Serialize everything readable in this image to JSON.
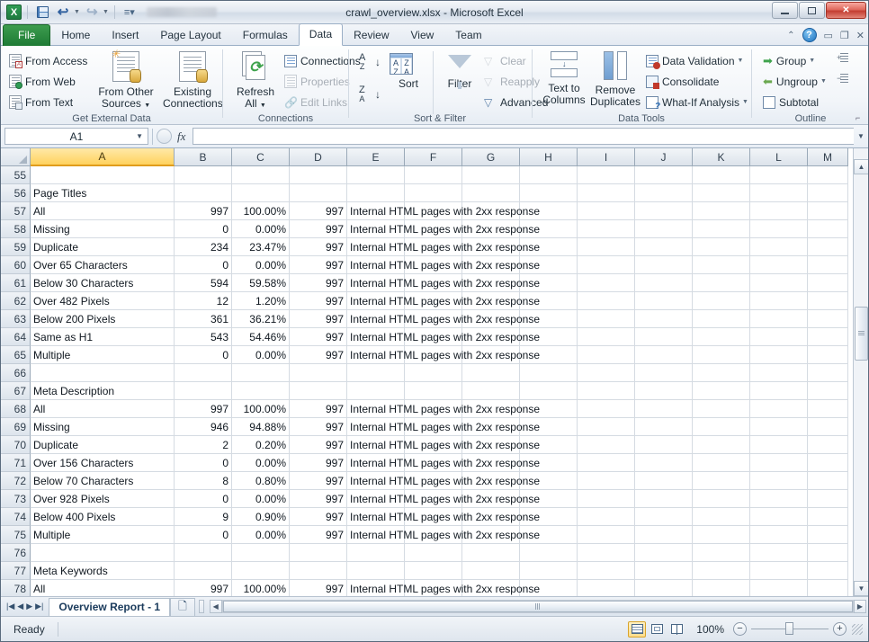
{
  "window": {
    "title": "crawl_overview.xlsx  -  Microsoft Excel",
    "quick_access": [
      "save-icon",
      "undo-icon",
      "redo-icon",
      "customize-icon"
    ],
    "controls": {
      "minimize": "—",
      "restore": "❐",
      "close": "✕"
    }
  },
  "ribbon": {
    "tabs": [
      {
        "label": "File",
        "active": false,
        "file": true
      },
      {
        "label": "Home",
        "active": false
      },
      {
        "label": "Insert",
        "active": false
      },
      {
        "label": "Page Layout",
        "active": false
      },
      {
        "label": "Formulas",
        "active": false
      },
      {
        "label": "Data",
        "active": true
      },
      {
        "label": "Review",
        "active": false
      },
      {
        "label": "View",
        "active": false
      },
      {
        "label": "Team",
        "active": false
      }
    ],
    "help_label": "?",
    "groups": {
      "get_external_data": {
        "title": "Get External Data",
        "from_access": "From Access",
        "from_web": "From Web",
        "from_text": "From Text",
        "from_other_sources_line1": "From Other",
        "from_other_sources_line2": "Sources",
        "existing_connections_line1": "Existing",
        "existing_connections_line2": "Connections"
      },
      "connections": {
        "title": "Connections",
        "refresh_all_line1": "Refresh",
        "refresh_all_line2": "All",
        "connections": "Connections",
        "properties": "Properties",
        "edit_links": "Edit Links"
      },
      "sort_filter": {
        "title": "Sort & Filter",
        "sort_asc": "A→Z",
        "sort_desc": "Z→A",
        "sort": "Sort",
        "filter": "Filter",
        "clear": "Clear",
        "reapply": "Reapply",
        "advanced": "Advanced"
      },
      "data_tools": {
        "title": "Data Tools",
        "text_to_columns_line1": "Text to",
        "text_to_columns_line2": "Columns",
        "remove_duplicates_line1": "Remove",
        "remove_duplicates_line2": "Duplicates",
        "data_validation": "Data Validation",
        "consolidate": "Consolidate",
        "what_if_analysis": "What-If Analysis"
      },
      "outline": {
        "title": "Outline",
        "group": "Group",
        "ungroup": "Ungroup",
        "subtotal": "Subtotal"
      }
    }
  },
  "formula_bar": {
    "name_box": "A1",
    "formula_value": "",
    "fx_label": "fx"
  },
  "grid": {
    "column_headers": [
      "A",
      "B",
      "C",
      "D",
      "E",
      "F",
      "G",
      "H",
      "I",
      "J",
      "K",
      "L",
      "M"
    ],
    "selected_column": "A",
    "selected_cell": "A1",
    "rows": [
      {
        "n": "55",
        "a": "",
        "b": "",
        "c": "",
        "d": "",
        "e": ""
      },
      {
        "n": "56",
        "a": "Page Titles",
        "b": "",
        "c": "",
        "d": "",
        "e": ""
      },
      {
        "n": "57",
        "a": "All",
        "b": "997",
        "c": "100.00%",
        "d": "997",
        "e": "Internal HTML pages with 2xx response"
      },
      {
        "n": "58",
        "a": "Missing",
        "b": "0",
        "c": "0.00%",
        "d": "997",
        "e": "Internal HTML pages with 2xx response"
      },
      {
        "n": "59",
        "a": "Duplicate",
        "b": "234",
        "c": "23.47%",
        "d": "997",
        "e": "Internal HTML pages with 2xx response"
      },
      {
        "n": "60",
        "a": "Over 65 Characters",
        "b": "0",
        "c": "0.00%",
        "d": "997",
        "e": "Internal HTML pages with 2xx response"
      },
      {
        "n": "61",
        "a": "Below 30 Characters",
        "b": "594",
        "c": "59.58%",
        "d": "997",
        "e": "Internal HTML pages with 2xx response"
      },
      {
        "n": "62",
        "a": "Over 482 Pixels",
        "b": "12",
        "c": "1.20%",
        "d": "997",
        "e": "Internal HTML pages with 2xx response"
      },
      {
        "n": "63",
        "a": "Below 200 Pixels",
        "b": "361",
        "c": "36.21%",
        "d": "997",
        "e": "Internal HTML pages with 2xx response"
      },
      {
        "n": "64",
        "a": "Same as H1",
        "b": "543",
        "c": "54.46%",
        "d": "997",
        "e": "Internal HTML pages with 2xx response"
      },
      {
        "n": "65",
        "a": "Multiple",
        "b": "0",
        "c": "0.00%",
        "d": "997",
        "e": "Internal HTML pages with 2xx response"
      },
      {
        "n": "66",
        "a": "",
        "b": "",
        "c": "",
        "d": "",
        "e": ""
      },
      {
        "n": "67",
        "a": "Meta Description",
        "b": "",
        "c": "",
        "d": "",
        "e": ""
      },
      {
        "n": "68",
        "a": "All",
        "b": "997",
        "c": "100.00%",
        "d": "997",
        "e": "Internal HTML pages with 2xx response"
      },
      {
        "n": "69",
        "a": "Missing",
        "b": "946",
        "c": "94.88%",
        "d": "997",
        "e": "Internal HTML pages with 2xx response"
      },
      {
        "n": "70",
        "a": "Duplicate",
        "b": "2",
        "c": "0.20%",
        "d": "997",
        "e": "Internal HTML pages with 2xx response"
      },
      {
        "n": "71",
        "a": "Over 156 Characters",
        "b": "0",
        "c": "0.00%",
        "d": "997",
        "e": "Internal HTML pages with 2xx response"
      },
      {
        "n": "72",
        "a": "Below 70 Characters",
        "b": "8",
        "c": "0.80%",
        "d": "997",
        "e": "Internal HTML pages with 2xx response"
      },
      {
        "n": "73",
        "a": "Over 928 Pixels",
        "b": "0",
        "c": "0.00%",
        "d": "997",
        "e": "Internal HTML pages with 2xx response"
      },
      {
        "n": "74",
        "a": "Below 400 Pixels",
        "b": "9",
        "c": "0.90%",
        "d": "997",
        "e": "Internal HTML pages with 2xx response"
      },
      {
        "n": "75",
        "a": "Multiple",
        "b": "0",
        "c": "0.00%",
        "d": "997",
        "e": "Internal HTML pages with 2xx response"
      },
      {
        "n": "76",
        "a": "",
        "b": "",
        "c": "",
        "d": "",
        "e": ""
      },
      {
        "n": "77",
        "a": "Meta Keywords",
        "b": "",
        "c": "",
        "d": "",
        "e": ""
      },
      {
        "n": "78",
        "a": "All",
        "b": "997",
        "c": "100.00%",
        "d": "997",
        "e": "Internal HTML pages with 2xx response"
      }
    ]
  },
  "sheet_tabs": {
    "active": "Overview Report - 1",
    "insert_label": ""
  },
  "status_bar": {
    "status": "Ready",
    "zoom": "100%",
    "views": [
      "normal-view",
      "page-layout-view",
      "page-break-view"
    ]
  }
}
